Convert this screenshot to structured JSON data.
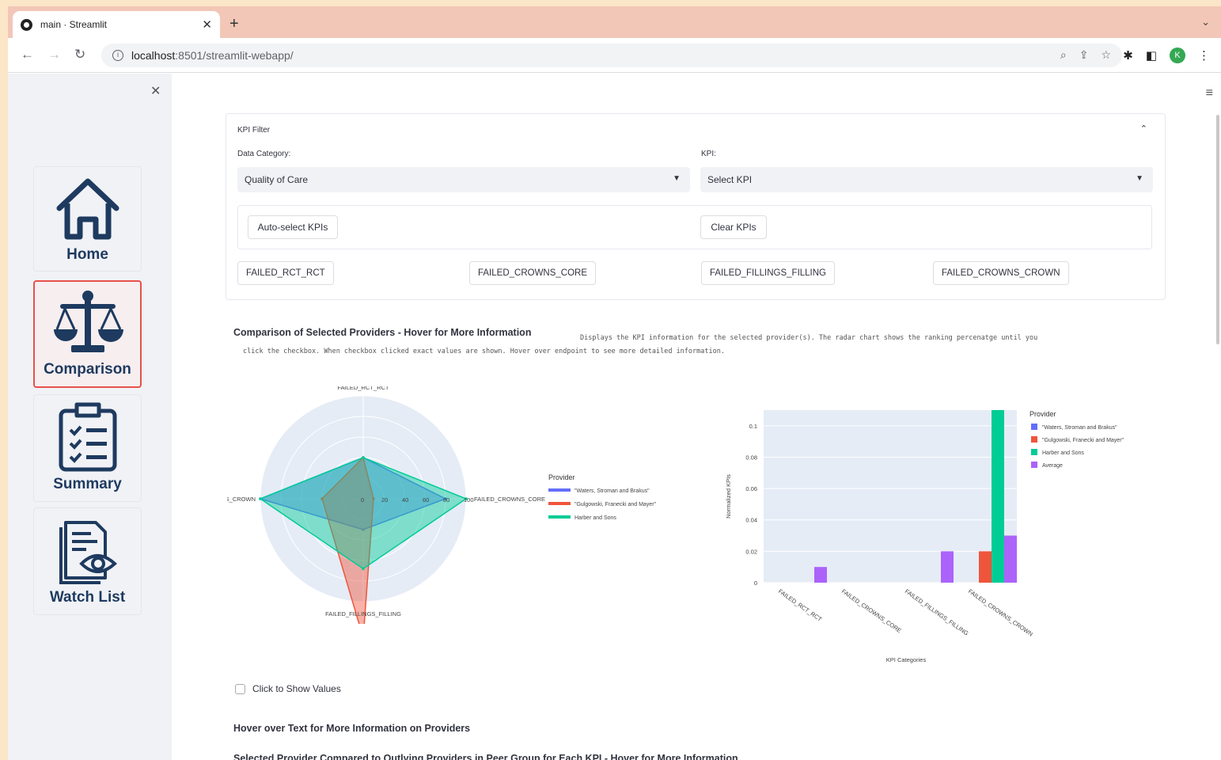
{
  "browser": {
    "tab_title": "main · Streamlit",
    "url_host": "localhost",
    "url_rest": ":8501/streamlit-webapp/",
    "profile_initial": "K"
  },
  "sidebar": {
    "items": [
      {
        "label": "Home",
        "icon": "home-icon",
        "active": false
      },
      {
        "label": "Comparison",
        "icon": "scale-icon",
        "active": true
      },
      {
        "label": "Summary",
        "icon": "clipboard-checklist-icon",
        "active": false
      },
      {
        "label": "Watch List",
        "icon": "document-eye-icon",
        "active": false
      }
    ]
  },
  "kpi_filter": {
    "title": "KPI Filter",
    "data_category_label": "Data Category:",
    "data_category_value": "Quality of Care",
    "kpi_label": "KPI:",
    "kpi_placeholder": "Select KPI",
    "auto_select_label": "Auto-select KPIs",
    "clear_label": "Clear KPIs",
    "selected_kpis": [
      "FAILED_RCT_RCT",
      "FAILED_CROWNS_CORE",
      "FAILED_FILLINGS_FILLING",
      "FAILED_CROWNS_CROWN"
    ]
  },
  "comparison": {
    "heading": "Comparison of Selected Providers - Hover for More Information",
    "description_line1": "Displays the KPI information for the selected provider(s). The radar chart shows the ranking percenatge until you",
    "description_line2": "click the checkbox. When checkbox clicked exact values are shown. Hover over endpoint to see more detailed information."
  },
  "colors": {
    "waters": "#636efa",
    "gulgowski": "#ef553b",
    "harber": "#00cc96",
    "average": "#ab63fa",
    "active_border": "#e8514a",
    "nav_text": "#1e3a5f"
  },
  "chart_data": [
    {
      "type": "radar",
      "axes": [
        "FAILED_RCT_RCT",
        "FAILED_CROWNS_CORE",
        "FAILED_FILLINGS_FILLING",
        "ED_CROWNS_CROWN"
      ],
      "radial_ticks": [
        "0",
        "20",
        "40",
        "60",
        "80",
        "100"
      ],
      "radial_range": [
        0,
        100
      ],
      "legend_title": "Provider",
      "legend_placement": "right",
      "series": [
        {
          "name": "\"Waters, Stroman and Brakus\"",
          "values": [
            40,
            80,
            30,
            100
          ]
        },
        {
          "name": "\"Gulgowski, Franecki and Mayer\"",
          "values": [
            40,
            10,
            135,
            40
          ]
        },
        {
          "name": "Harber and Sons",
          "values": [
            40,
            100,
            68,
            100
          ]
        }
      ]
    },
    {
      "type": "bar",
      "categories": [
        "FAILED_RCT_RCT",
        "FAILED_CROWNS_CORE",
        "FAILED_FILLINGS_FILLING",
        "FAILED_CROWNS_CROWN"
      ],
      "xlabel": "KPI Categories",
      "ylabel": "Normalized KPIs",
      "ylim": [
        0,
        0.11
      ],
      "yticks": [
        "0",
        "0.02",
        "0.04",
        "0.06",
        "0.08",
        "0.1"
      ],
      "legend_title": "Provider",
      "legend_placement": "right",
      "grid": true,
      "series": [
        {
          "name": "\"Waters, Stroman and Brakus\"",
          "values": [
            0,
            0,
            0,
            0
          ]
        },
        {
          "name": "\"Gulgowski, Franecki and Mayer\"",
          "values": [
            0,
            0,
            0,
            0.02
          ]
        },
        {
          "name": "Harber and Sons",
          "values": [
            0,
            0,
            0,
            0.11
          ]
        },
        {
          "name": "Average",
          "values": [
            0.01,
            0,
            0.02,
            0.03
          ]
        }
      ]
    }
  ],
  "show_values_label": "Click to Show Values",
  "hover_text_heading": "Hover over Text for More Information on Providers",
  "outlying_heading": "Selected Provider Compared to Outlying Providers in Peer Group for Each KPI - Hover for More Information"
}
